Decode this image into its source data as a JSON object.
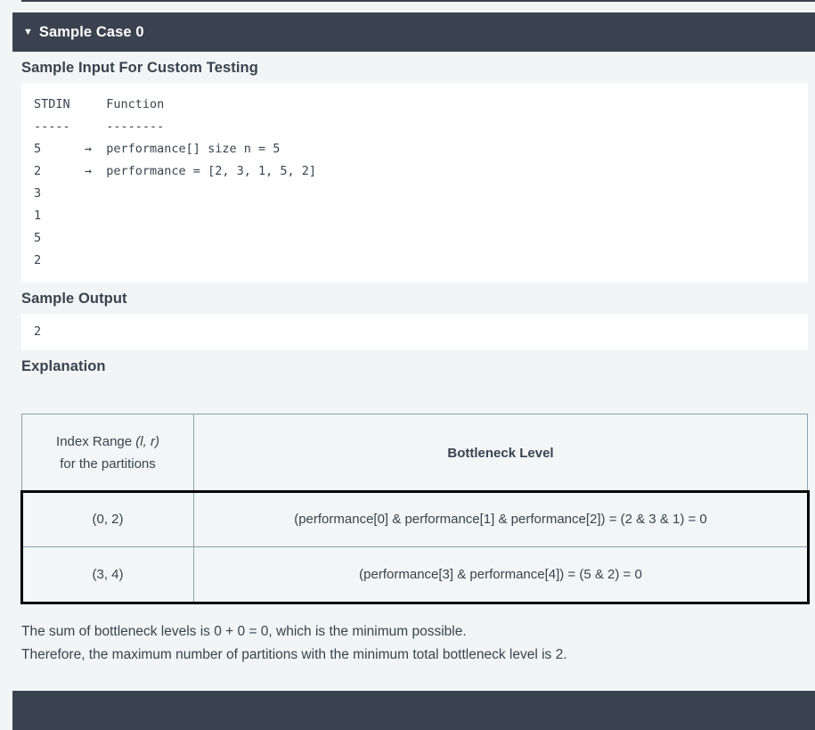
{
  "testcase": {
    "caret_glyph": "▼",
    "title": "Sample Case 0",
    "expanded": true
  },
  "sample_input": {
    "heading": "Sample Input For Custom Testing",
    "code": "STDIN     Function\n-----     --------\n5      →  performance[] size n = 5\n2      →  performance = [2, 3, 1, 5, 2]\n3\n1\n5\n2"
  },
  "sample_output": {
    "heading": "Sample Output",
    "code": "2"
  },
  "explanation": {
    "heading": "Explanation",
    "table": {
      "headers": {
        "col1_line1_prefix": "Index Range ",
        "col1_line1_italic": "(l, r)",
        "col1_line2": "for the partitions",
        "col2": "Bottleneck Level"
      },
      "rows": [
        {
          "index_range": "(0, 2)",
          "bottleneck_level": "(performance[0] & performance[1] & performance[2]) = (2 & 3 & 1) = 0"
        },
        {
          "index_range": "(3, 4)",
          "bottleneck_level": "(performance[3] & performance[4]) = (5 & 2) = 0"
        }
      ]
    },
    "paragraph_line1": "The sum of bottleneck levels is 0 + 0 = 0, which is the minimum possible.",
    "paragraph_line2": "Therefore, the maximum number of partitions with the minimum total bottleneck level is 2."
  },
  "colors": {
    "page_background": "#f1f5f6",
    "header_background": "#3a4250",
    "header_text": "#ffffff",
    "body_text": "#39424e",
    "code_background": "#ffffff",
    "table_border": "#8aa3ad",
    "table_emphasis_border": "#000000",
    "table_cell_background": "#f2f6f7"
  }
}
